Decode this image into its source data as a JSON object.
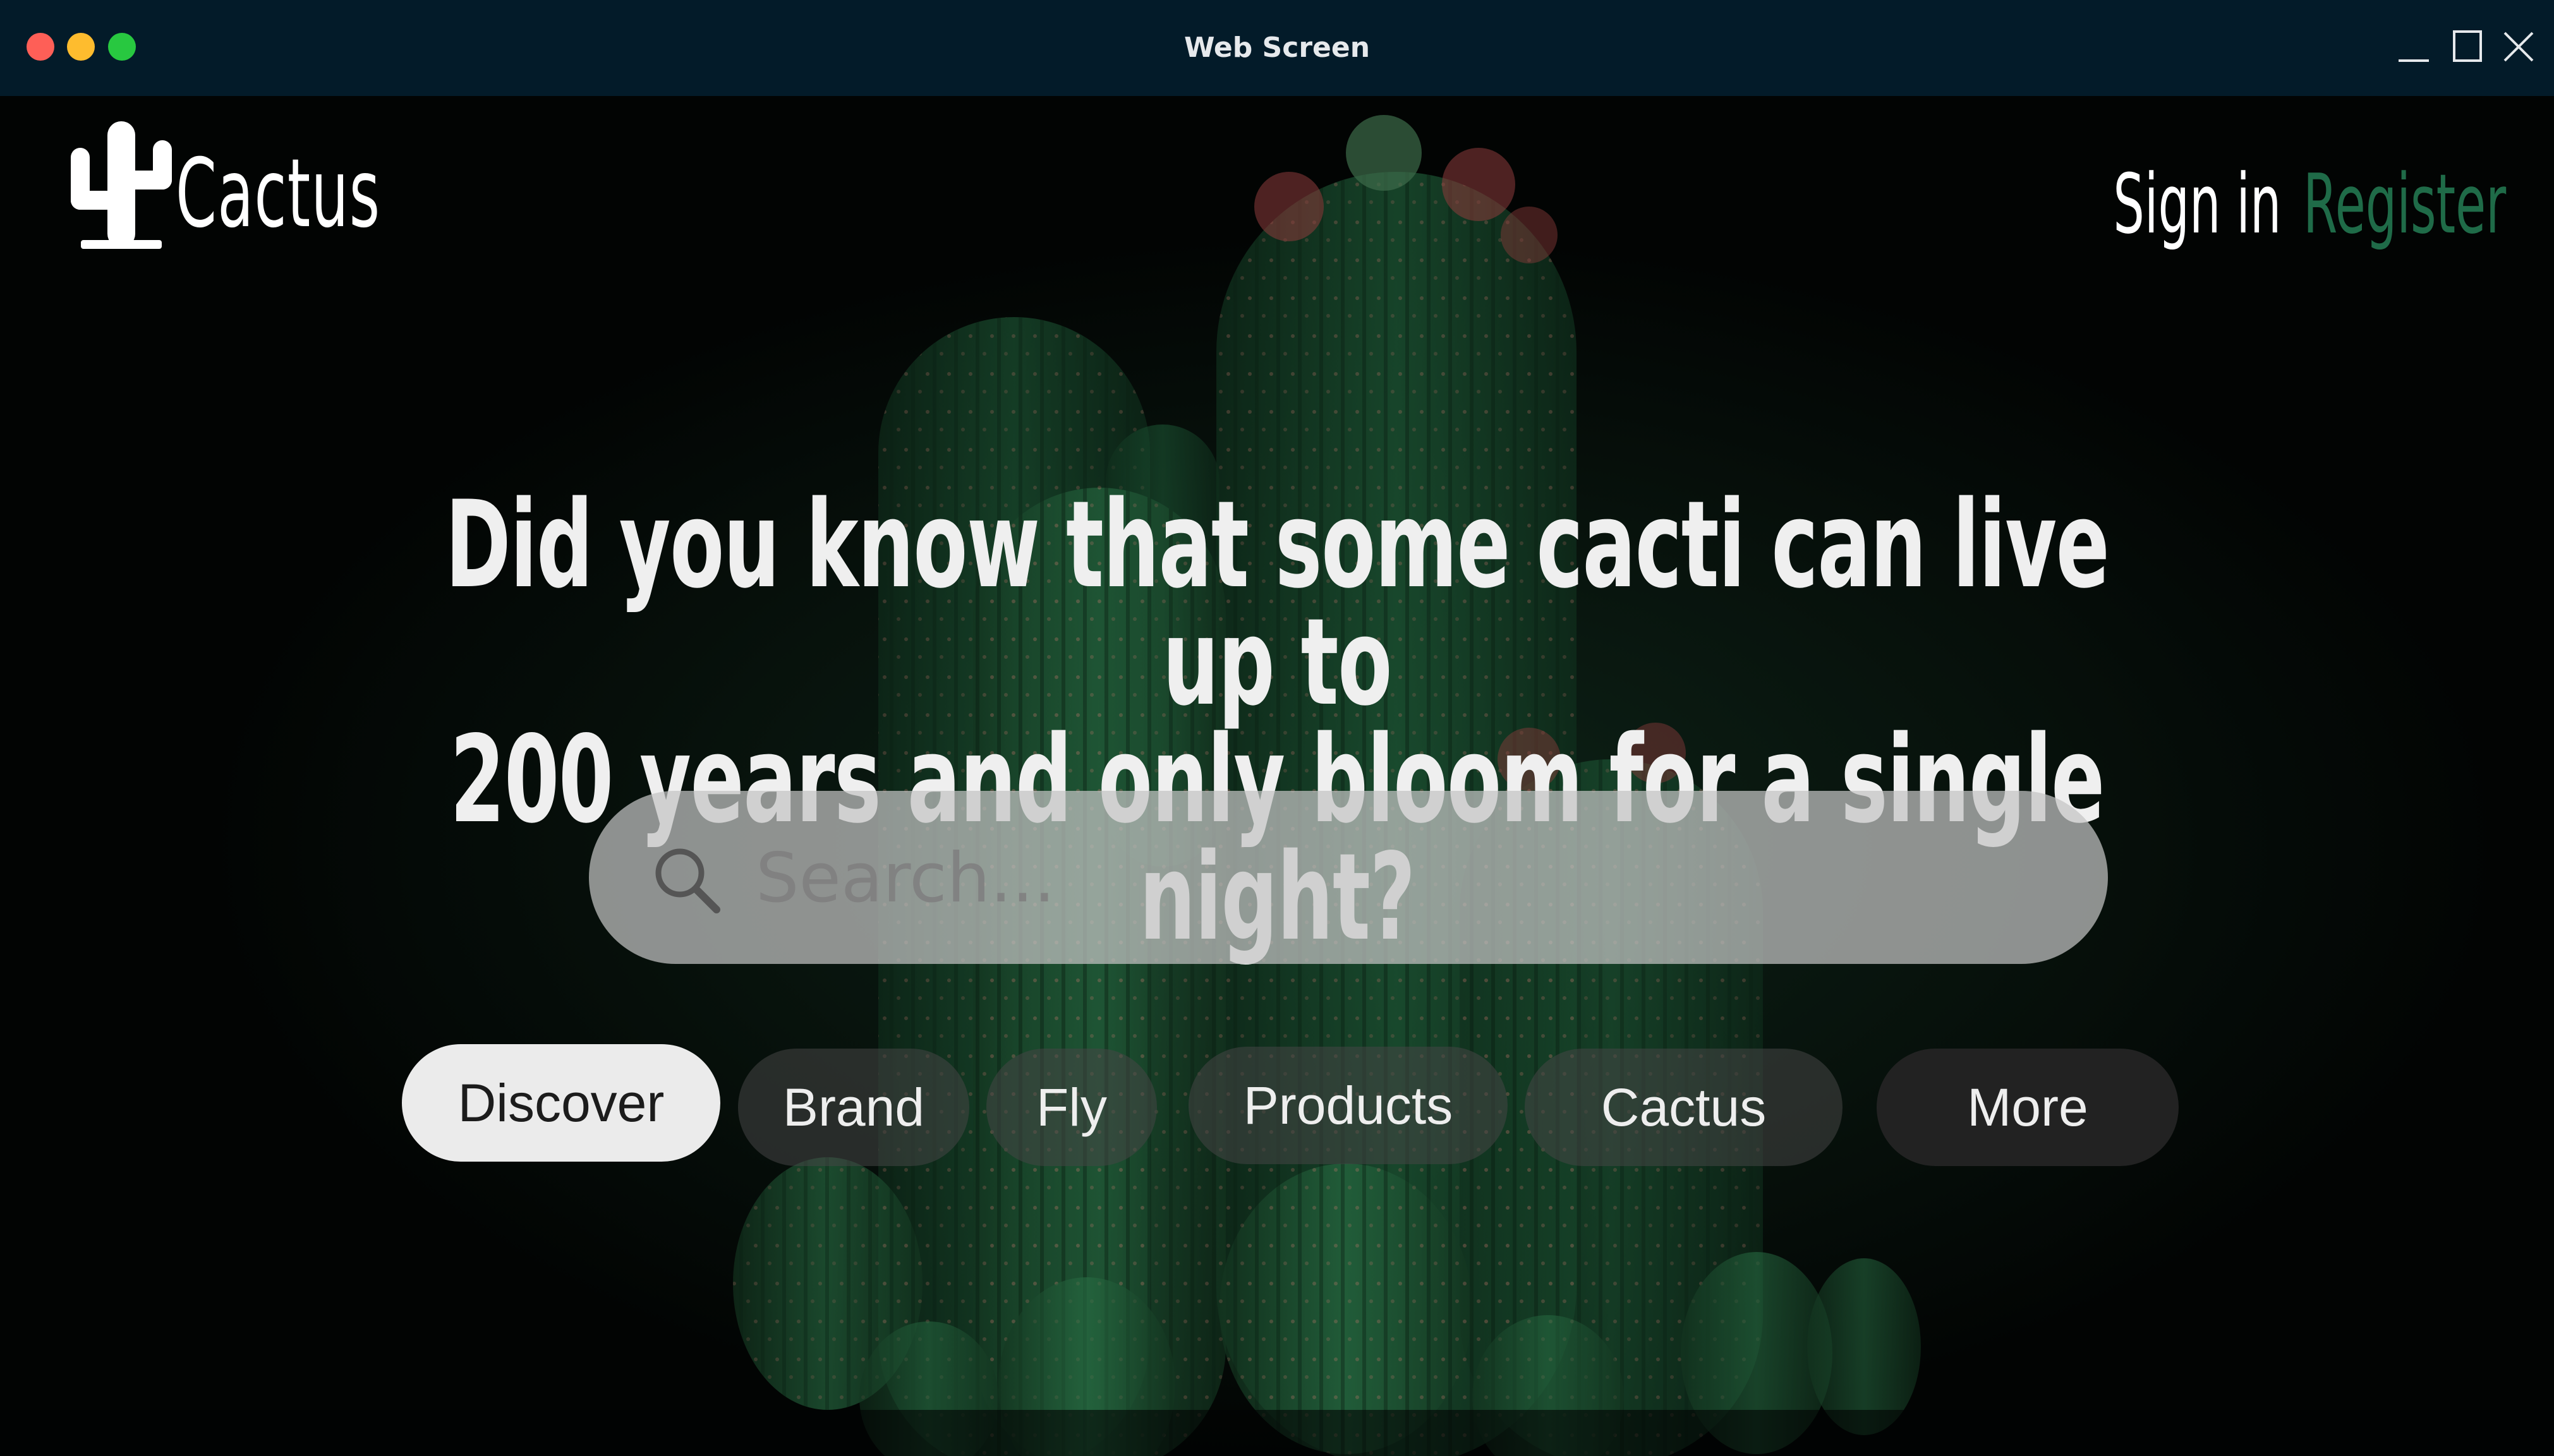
{
  "window": {
    "title": "Web Screen"
  },
  "header": {
    "logo_text": "Cactus",
    "sign_in_label": "Sign in",
    "register_label": "Register"
  },
  "hero": {
    "headline_line1": "Did you know that some cacti can live up to",
    "headline_line2": "200 years and only bloom for a single night?"
  },
  "search": {
    "placeholder": "Search...",
    "value": ""
  },
  "categories": [
    {
      "label": "Discover",
      "state": "active"
    },
    {
      "label": "Brand",
      "state": "default"
    },
    {
      "label": "Fly",
      "state": "default"
    },
    {
      "label": "Products",
      "state": "default"
    },
    {
      "label": "Cactus",
      "state": "default"
    },
    {
      "label": "More",
      "state": "default"
    }
  ],
  "colors": {
    "titlebar": "#031b29",
    "register_accent": "#1f6b48",
    "active_pill": "#ebebeb",
    "more_pill": "#222222",
    "cactus_green": "#1d5a35"
  }
}
